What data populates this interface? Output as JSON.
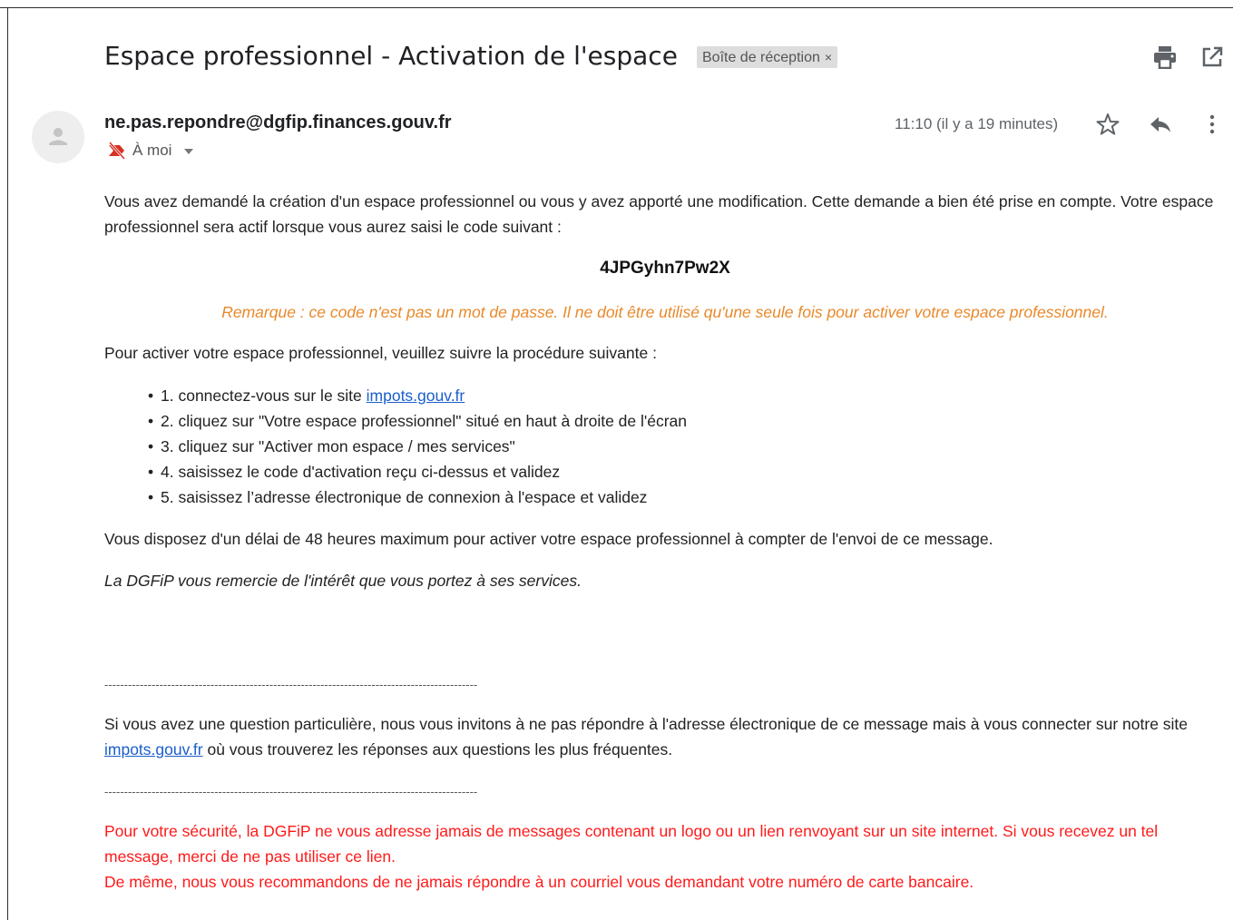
{
  "email": {
    "subject": "Espace professionnel - Activation de l'espace",
    "label": "Boîte de réception",
    "label_close": "×",
    "sender": "ne.pas.repondre@dgfip.finances.gouv.fr",
    "to": "À moi",
    "timestamp": "11:10 (il y a 19 minutes)"
  },
  "icons": {
    "print": "print-icon",
    "open_new_window": "open-in-new-window-icon",
    "avatar": "person-avatar-icon",
    "not_important": "important-marker-icon",
    "dropdown": "chevron-down-icon",
    "star": "star-icon",
    "reply": "reply-icon",
    "more": "more-vertical-icon"
  },
  "body": {
    "intro": "Vous avez demandé la création d'un espace professionnel ou vous y avez apporté une modification. Cette demande a bien été prise en compte. Votre espace professionnel sera actif lorsque vous aurez saisi le code suivant :",
    "code": "4JPGyhn7Pw2X",
    "remark": "Remarque : ce code n'est pas un mot de passe. Il ne doit être utilisé qu'une seule fois pour activer votre espace professionnel.",
    "procedure_intro": "Pour activer votre espace professionnel, veuillez suivre la procédure suivante :",
    "step1_text": "1. connectez-vous sur le site ",
    "step1_link": "impots.gouv.fr",
    "step2": "2. cliquez sur \"Votre espace professionnel\" situé en haut à droite de l'écran",
    "step3": "3. cliquez sur \"Activer mon espace / mes services\"",
    "step4": "4. saisissez le code d'activation reçu ci-dessus et validez",
    "step5": "5. saisissez l’adresse électronique de connexion à l'espace et validez",
    "delay": "Vous disposez d'un délai de 48 heures maximum pour activer votre espace professionnel à compter de l'envoi de ce message.",
    "thanks": "La DGFiP vous remercie de l'intérêt que vous portez à ses services.",
    "divider": "-----------------------------------------------------------------------------------------------",
    "question_text": "Si vous avez une question particulière, nous vous invitons à ne pas répondre à l'adresse électronique de ce message mais à vous connecter sur notre site ",
    "question_link": "impots.gouv.fr",
    "question_end": " où vous trouverez les réponses aux questions les plus fréquentes.",
    "security1": "Pour votre sécurité, la DGFiP ne vous adresse jamais de messages contenant un logo ou un lien renvoyant sur un site internet. Si vous recevez un tel message, merci de ne pas utiliser ce lien.",
    "security2": "De même, nous vous recommandons de ne jamais répondre à un courriel vous demandant votre numéro de carte bancaire."
  },
  "colors": {
    "remark": "#e8892b",
    "security": "#ff1a1a",
    "link": "#1a5fcc",
    "label_chip": "#dddddd"
  }
}
